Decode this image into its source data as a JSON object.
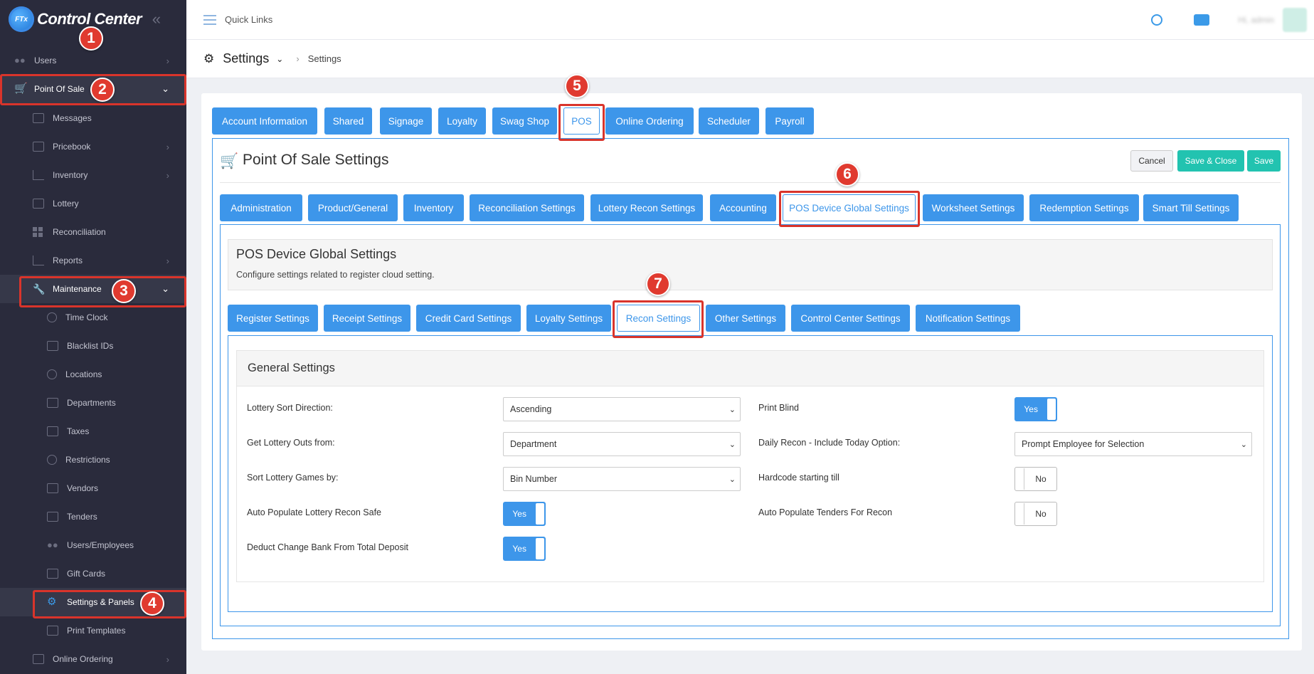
{
  "brand": {
    "title": "Control Center",
    "logo_text": "FTx"
  },
  "sidebar": {
    "items": [
      {
        "label": "Users",
        "icon": "users-icon",
        "chevron": "›"
      },
      {
        "label": "Point Of Sale",
        "icon": "cart-icon",
        "chevron": "⌄"
      },
      {
        "label": "Messages",
        "icon": "message-icon"
      },
      {
        "label": "Pricebook",
        "icon": "calculator-icon",
        "chevron": "›"
      },
      {
        "label": "Inventory",
        "icon": "inventory-icon",
        "chevron": "›"
      },
      {
        "label": "Lottery",
        "icon": "lottery-icon"
      },
      {
        "label": "Reconciliation",
        "icon": "grid-icon"
      },
      {
        "label": "Reports",
        "icon": "chart-icon",
        "chevron": "›"
      },
      {
        "label": "Maintenance",
        "icon": "wrench-icon",
        "chevron": "⌄"
      },
      {
        "label": "Time Clock",
        "icon": "clock-icon"
      },
      {
        "label": "Blacklist IDs",
        "icon": "id-card-icon"
      },
      {
        "label": "Locations",
        "icon": "location-icon"
      },
      {
        "label": "Departments",
        "icon": "department-icon"
      },
      {
        "label": "Taxes",
        "icon": "tax-icon"
      },
      {
        "label": "Restrictions",
        "icon": "ban-icon"
      },
      {
        "label": "Vendors",
        "icon": "vendor-icon"
      },
      {
        "label": "Tenders",
        "icon": "tender-icon"
      },
      {
        "label": "Users/Employees",
        "icon": "users-icon"
      },
      {
        "label": "Gift Cards",
        "icon": "gift-card-icon"
      },
      {
        "label": "Settings & Panels",
        "icon": "gear-icon"
      },
      {
        "label": "Print Templates",
        "icon": "printer-icon"
      },
      {
        "label": "Online Ordering",
        "icon": "bag-icon",
        "chevron": "›"
      }
    ]
  },
  "annotations": [
    "1",
    "2",
    "3",
    "4",
    "5",
    "6",
    "7"
  ],
  "topbar": {
    "quick_links": "Quick Links",
    "user_name": "Hi, admin"
  },
  "breadcrumb": {
    "title": "Settings",
    "current": "Settings"
  },
  "top_tabs": [
    "Account Information",
    "Shared",
    "Signage",
    "Loyalty",
    "Swag Shop",
    "POS",
    "Online Ordering",
    "Scheduler",
    "Payroll"
  ],
  "pos_panel": {
    "title": "Point Of Sale Settings",
    "cancel": "Cancel",
    "save_close": "Save & Close",
    "save": "Save"
  },
  "pos_tabs": [
    "Administration",
    "Product/General",
    "Inventory",
    "Reconciliation Settings",
    "Lottery Recon Settings",
    "Accounting",
    "POS Device Global Settings",
    "Worksheet Settings",
    "Redemption Settings",
    "Smart Till Settings"
  ],
  "device_section": {
    "title": "POS Device Global Settings",
    "description": "Configure settings related to register cloud setting."
  },
  "device_tabs": [
    "Register Settings",
    "Receipt Settings",
    "Credit Card Settings",
    "Loyalty Settings",
    "Recon Settings",
    "Other Settings",
    "Control Center Settings",
    "Notification Settings"
  ],
  "general": {
    "title": "General Settings",
    "fields": {
      "lottery_sort_direction": {
        "label": "Lottery Sort Direction:",
        "value": "Ascending"
      },
      "lottery_outs_from": {
        "label": "Get Lottery Outs from:",
        "value": "Department"
      },
      "sort_lottery_games": {
        "label": "Sort Lottery Games by:",
        "value": "Bin Number"
      },
      "auto_populate_safe": {
        "label": "Auto Populate Lottery Recon Safe",
        "value": "Yes"
      },
      "deduct_change_bank": {
        "label": "Deduct Change Bank From Total Deposit",
        "value": "Yes"
      },
      "print_blind": {
        "label": "Print Blind",
        "value": "Yes"
      },
      "daily_recon_today": {
        "label": "Daily Recon - Include Today Option:",
        "value": "Prompt Employee for Selection"
      },
      "hardcode_starting_till": {
        "label": "Hardcode starting till",
        "value": "No"
      },
      "auto_populate_tenders": {
        "label": "Auto Populate Tenders For Recon",
        "value": "No"
      }
    }
  },
  "colors": {
    "accent": "#3d96ea",
    "teal": "#22c3b0",
    "sidebar": "#2a2b3c",
    "annotation": "#d9342b"
  }
}
